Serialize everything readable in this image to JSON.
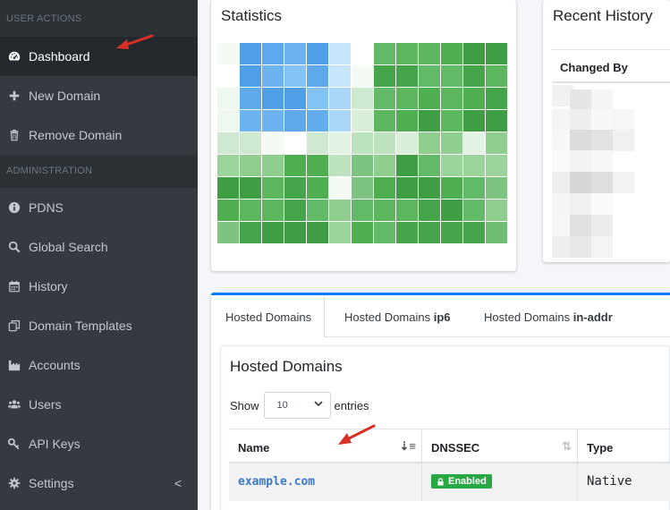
{
  "sidebar": {
    "sections": [
      {
        "header": "USER ACTIONS"
      },
      {
        "header": "ADMINISTRATION"
      }
    ],
    "user_items": [
      {
        "label": "Dashboard",
        "icon": "tachometer-icon"
      },
      {
        "label": "New Domain",
        "icon": "plus-icon"
      },
      {
        "label": "Remove Domain",
        "icon": "trash-icon"
      }
    ],
    "admin_items": [
      {
        "label": "PDNS",
        "icon": "info-circle-icon"
      },
      {
        "label": "Global Search",
        "icon": "search-icon"
      },
      {
        "label": "History",
        "icon": "calendar-icon"
      },
      {
        "label": "Domain Templates",
        "icon": "clone-icon"
      },
      {
        "label": "Accounts",
        "icon": "industry-icon"
      },
      {
        "label": "Users",
        "icon": "users-icon"
      },
      {
        "label": "API Keys",
        "icon": "key-icon"
      },
      {
        "label": "Settings",
        "icon": "gear-icon"
      }
    ],
    "collapse_glyph": "<"
  },
  "statistics": {
    "title": "Statistics"
  },
  "recent_history": {
    "title": "Recent History",
    "column": "Changed By"
  },
  "tabs": {
    "hosted": "Hosted Domains",
    "ip6_prefix": "Hosted Domains ",
    "ip6_bold": "ip6",
    "inaddr_prefix": "Hosted Domains ",
    "inaddr_bold": "in-addr"
  },
  "domains_panel": {
    "title": "Hosted Domains",
    "show_label": "Show",
    "entries_value": "10",
    "entries_label": "entries",
    "columns": [
      "Name",
      "DNSSEC",
      "Type"
    ],
    "rows": [
      {
        "name": "example.com",
        "dnssec": "Enabled",
        "type": "Native"
      }
    ]
  },
  "colors": {
    "sidebar_bg": "#343a40",
    "accent": "#007bff",
    "enabled_badge": "#28a745",
    "link": "#3c7ac8",
    "annotation_arrow": "#d93025"
  }
}
